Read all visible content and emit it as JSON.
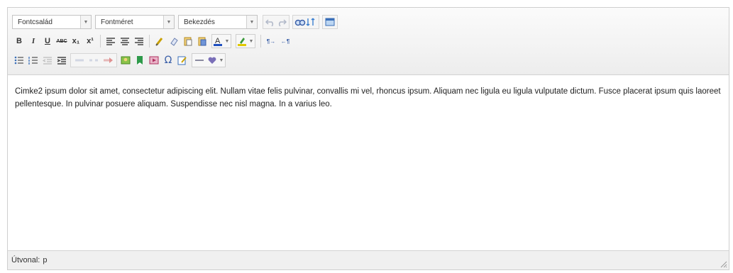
{
  "toolbar": {
    "font_family": "Fontcsalád",
    "font_size": "Fontméret",
    "block_format": "Bekezdés",
    "icons": {
      "undo": "undo-icon",
      "redo": "redo-icon",
      "find": "find-icon",
      "replace": "replace-icon",
      "fullscreen": "fullscreen-icon",
      "bold": "B",
      "italic": "I",
      "underline": "U",
      "strike": "ABC",
      "subscript": "x₁",
      "superscript": "x¹",
      "text_color": "A",
      "ltr": "¶→",
      "rtl": "←¶",
      "omega": "Ω"
    }
  },
  "content": {
    "text": "Cimke2 ipsum dolor sit amet, consectetur adipiscing elit. Nullam vitae felis pulvinar, convallis mi vel, rhoncus ipsum. Aliquam nec ligula eu ligula vulputate dictum. Fusce placerat ipsum quis laoreet pellentesque. In pulvinar posuere aliquam. Suspendisse nec nisl magna. In a varius leo."
  },
  "status": {
    "path_label": "Útvonal:",
    "path_value": "p"
  },
  "colors": {
    "border": "#cfcfcf",
    "toolbar_bg": "#ededed",
    "text_color_bar": "#1f4fbf",
    "highlight_bar": "#e0c800"
  }
}
